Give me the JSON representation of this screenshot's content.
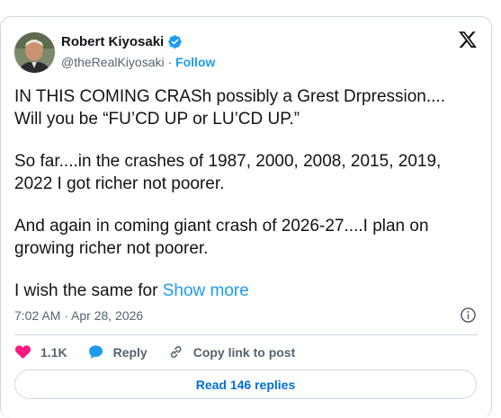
{
  "author": {
    "name": "Robert Kiyosaki",
    "handle": "@theRealKiyosaki",
    "separator": "·",
    "follow_label": "Follow"
  },
  "tweet": {
    "paragraphs": [
      "IN THIS COMING CRASh possibly a Grest Drpression....\nWill you be “FU’CD UP or LU’CD UP.”",
      "So far....in the crashes of 1987, 2000, 2008, 2015, 2019,\n2022 I got richer not poorer.",
      "And again in coming giant crash of 2026-27....I plan on\ngrowing richer not poorer."
    ],
    "truncated_text": "I wish the same for ",
    "show_more_label": "Show more",
    "timestamp": "7:02 AM · Apr 28, 2026"
  },
  "actions": {
    "like_count": "1.1K",
    "reply_label": "Reply",
    "copy_link_label": "Copy link to post"
  },
  "read_replies_label": "Read 146 replies",
  "colors": {
    "accent": "#1d9bf0",
    "like": "#f91880",
    "link_dark": "#006fd6",
    "muted": "#536471",
    "border": "#cfd9de"
  },
  "icons": [
    "verified-badge-icon",
    "x-logo-icon",
    "info-icon",
    "heart-icon",
    "reply-bubble-icon",
    "link-icon"
  ]
}
